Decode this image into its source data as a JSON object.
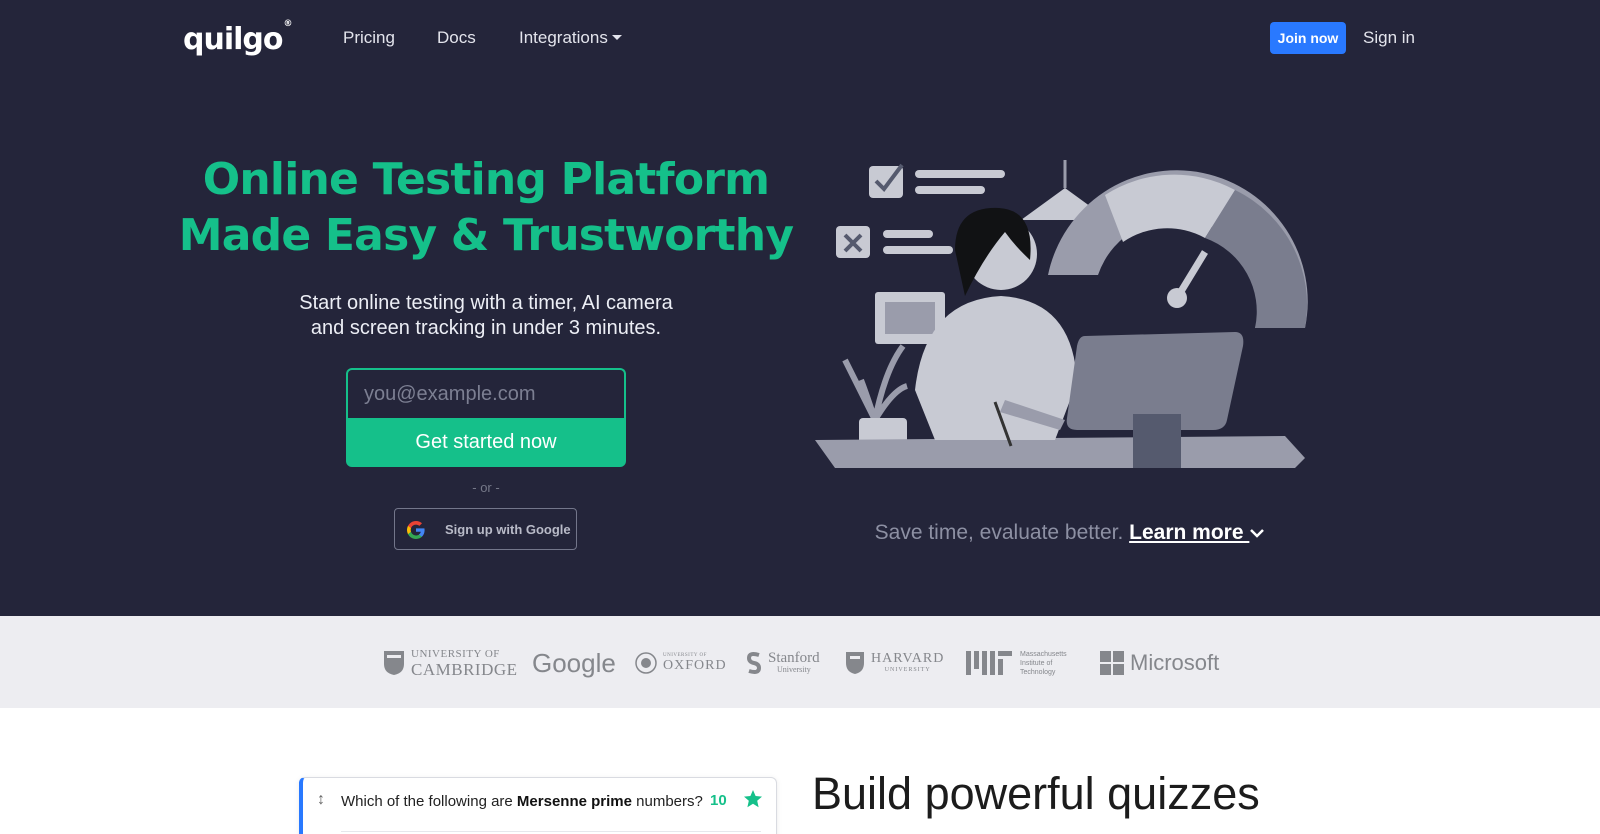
{
  "nav": {
    "logo_text": "quilgo",
    "logo_mark": "®",
    "links": [
      "Pricing",
      "Docs",
      "Integrations"
    ],
    "join_label": "Join now",
    "signin_label": "Sign in"
  },
  "hero": {
    "title_line1": "Online Testing Platform",
    "title_line2": "Made Easy & Trustworthy",
    "subtitle_line1": "Start online testing with a timer, AI camera",
    "subtitle_line2": "and screen tracking in under 3 minutes.",
    "email_placeholder": "you@example.com",
    "cta_label": "Get started now",
    "or_text": "- or -",
    "google_label": "Sign up with Google",
    "tagline": "Save time, evaluate better.",
    "learn_more": "Learn more"
  },
  "logos": {
    "cambridge_small": "UNIVERSITY OF",
    "cambridge_big": "CAMBRIDGE",
    "google": "Google",
    "oxford_small": "UNIVERSITY OF",
    "oxford_big": "OXFORD",
    "stanford_big": "Stanford",
    "stanford_small": "University",
    "harvard_big": "HARVARD",
    "harvard_small": "UNIVERSITY",
    "mit_line1": "Massachusetts",
    "mit_line2": "Institute of",
    "mit_line3": "Technology",
    "microsoft": "Microsoft"
  },
  "quiz": {
    "question_prefix": "Which of the following are ",
    "question_bold": "Mersenne prime",
    "question_suffix": " numbers?",
    "points": "10"
  },
  "section": {
    "heading": "Build powerful quizzes"
  },
  "colors": {
    "hero_bg": "#24253a",
    "accent_green": "#15c08a",
    "accent_blue": "#2979ff",
    "logos_bg": "#ededf1"
  },
  "icons": [
    "google-g-icon",
    "caret-down-icon",
    "chevron-down-icon",
    "drag-handle-icon",
    "star-icon"
  ]
}
